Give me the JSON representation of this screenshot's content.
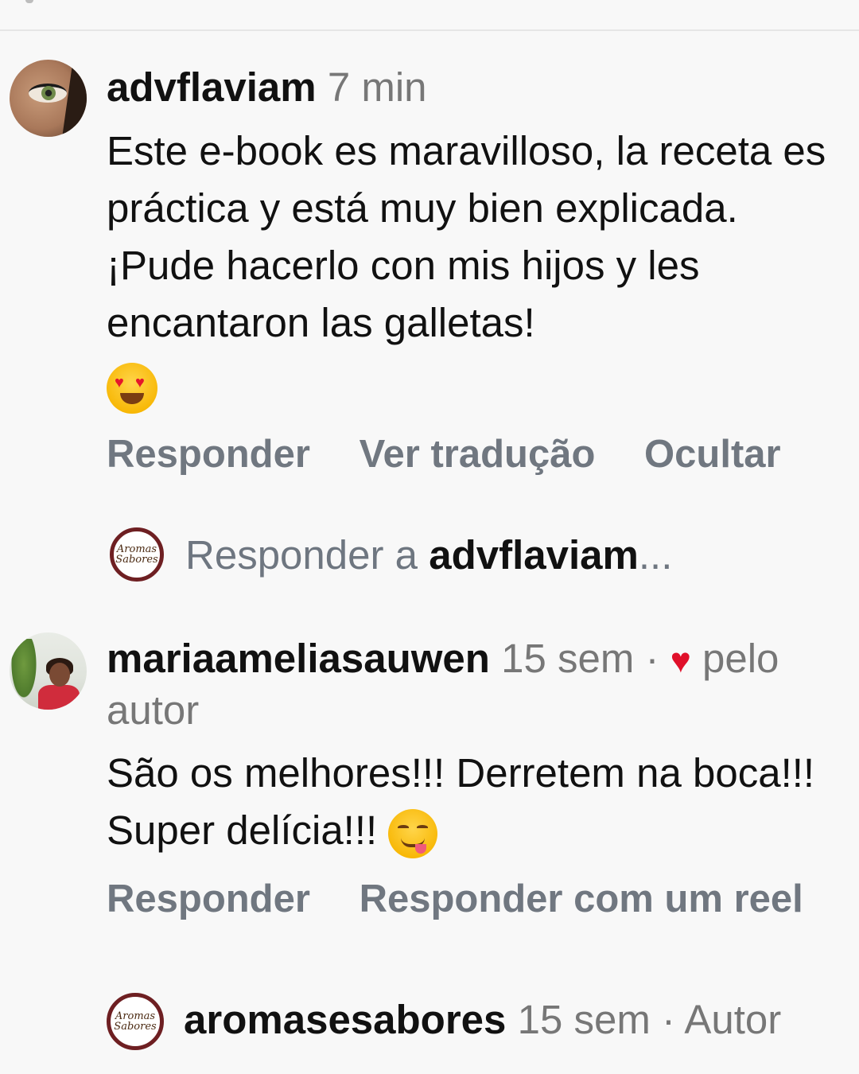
{
  "comments": [
    {
      "username": "advflaviam",
      "time": "7 min",
      "text": "Este e-book es maravilloso, la receta es práctica y está muy bien explicada. ¡Pude hacerlo con mis hijos y les encantaron las galletas!",
      "actions": [
        "Responder",
        "Ver tradução",
        "Ocultar"
      ],
      "avatar_icon": "eye-closeup-avatar",
      "emoji": "heart-eyes-emoji"
    },
    {
      "username": "mariaameliasauwen",
      "time": "15 sem",
      "liked_by_author": "pelo autor",
      "separator": "·",
      "text": "São os melhores!!! Derretem na boca!!! Super delícia!!!",
      "actions": [
        "Responder",
        "Responder com um reel"
      ],
      "avatar_icon": "woman-photo-avatar",
      "emoji": "yum-emoji"
    },
    {
      "username": "aromasesabores",
      "time": "15 sem",
      "separator": "·",
      "badge": "Autor",
      "avatar_icon": "aromas-sabores-logo-avatar"
    }
  ],
  "reply_prompt": {
    "prefix": "Responder a ",
    "target": "advflaviam",
    "suffix": "..."
  },
  "brand_logo": {
    "line1": "Aromas",
    "line2": "Sabores"
  },
  "colors": {
    "background": "#f8f8f8",
    "action_gray": "#707780",
    "heart_red": "#e0102a",
    "mention_blue": "#2b6cd8"
  }
}
